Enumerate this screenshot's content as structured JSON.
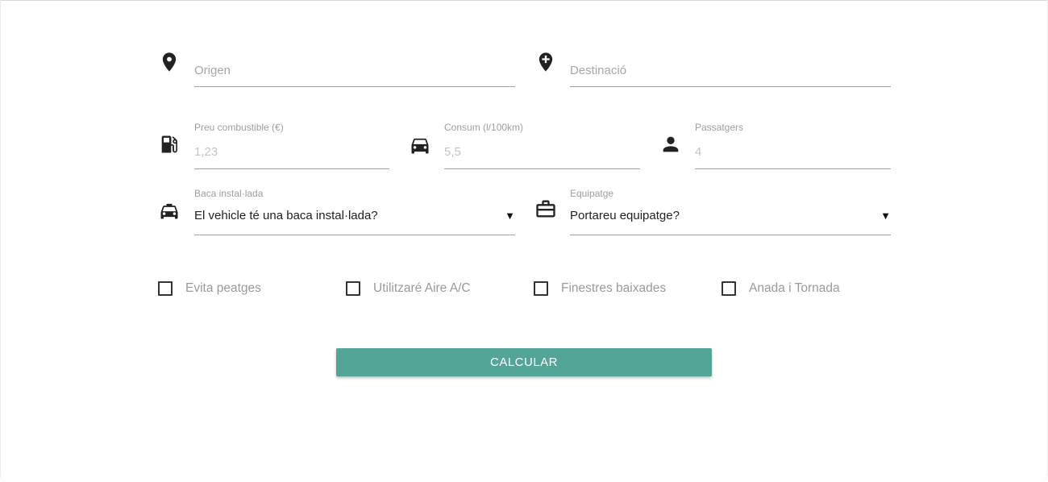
{
  "origin": {
    "placeholder": "Origen",
    "icon": "location-pin-icon"
  },
  "destination": {
    "placeholder": "Destinació",
    "icon": "add-location-icon"
  },
  "fuel_price": {
    "label": "Preu combustible (€)",
    "placeholder": "1,23",
    "icon": "gas-station-icon"
  },
  "consumption": {
    "label": "Consum (l/100km)",
    "placeholder": "5,5",
    "icon": "car-icon"
  },
  "passengers": {
    "label": "Passatgers",
    "placeholder": "4",
    "icon": "person-icon"
  },
  "roof_rack": {
    "label": "Baca instal·lada",
    "value": "El vehicle té una baca instal·lada?",
    "icon": "taxi-icon"
  },
  "luggage": {
    "label": "Equipatge",
    "value": "Portareu equipatge?",
    "icon": "briefcase-icon"
  },
  "options": [
    {
      "label": "Evita peatges",
      "checked": false
    },
    {
      "label": "Utilitzaré Aire A/C",
      "checked": false
    },
    {
      "label": "Finestres baixades",
      "checked": false
    },
    {
      "label": "Anada i Tornada",
      "checked": false
    }
  ],
  "submit": {
    "label": "CALCULAR",
    "color": "#52a597"
  }
}
